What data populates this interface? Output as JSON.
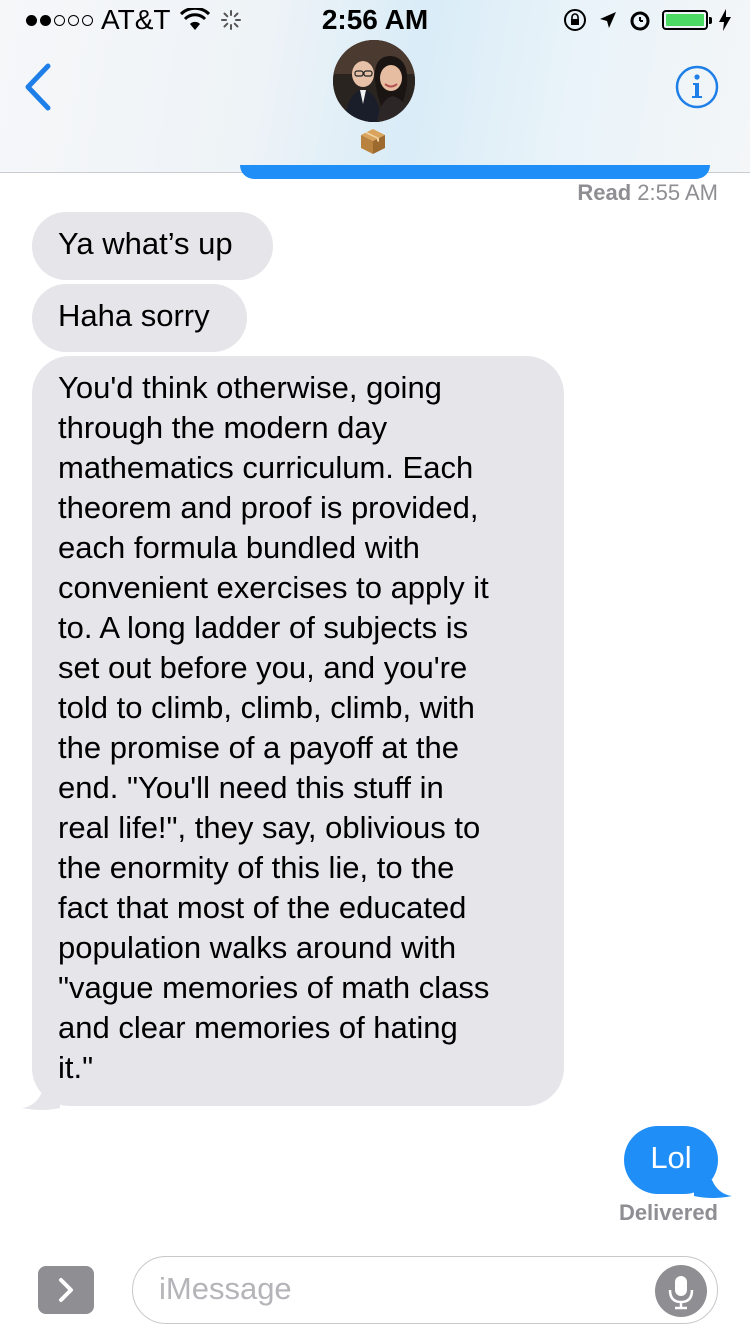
{
  "status_bar": {
    "carrier": "AT&T",
    "time": "2:56 AM",
    "battery_color": "#4cd964"
  },
  "header": {
    "back_icon": "chevron-left-icon",
    "info_icon": "info-icon",
    "contact_icon": "package-icon",
    "accent": "#1f7fe8"
  },
  "messages": {
    "read_label": "Read",
    "read_time": "2:55 AM",
    "incoming": [
      "Ya what’s up",
      "Haha sorry"
    ],
    "long_message_lines": [
      "You'd think otherwise, going",
      "through the modern day",
      "mathematics curriculum. Each",
      "theorem and proof is provided,",
      "each formula bundled with",
      "convenient exercises to apply it",
      "to. A long ladder of subjects is",
      "set out before you, and you're",
      "told to climb, climb, climb, with",
      "the promise of a payoff at the",
      "end. \"You'll need this stuff in",
      "real life!\", they say, oblivious to",
      "the enormity of this lie, to the",
      "fact that most of the educated",
      "population walks around with",
      "\"vague memories of math class",
      "and clear memories of hating",
      "it.\""
    ],
    "outgoing": "Lol",
    "delivered": "Delivered",
    "incoming_color": "#e5e5ea",
    "outgoing_color": "#1f8ef6"
  },
  "composer": {
    "placeholder": "iMessage",
    "apps_icon": "chevron-right-icon",
    "mic_icon": "microphone-icon"
  }
}
